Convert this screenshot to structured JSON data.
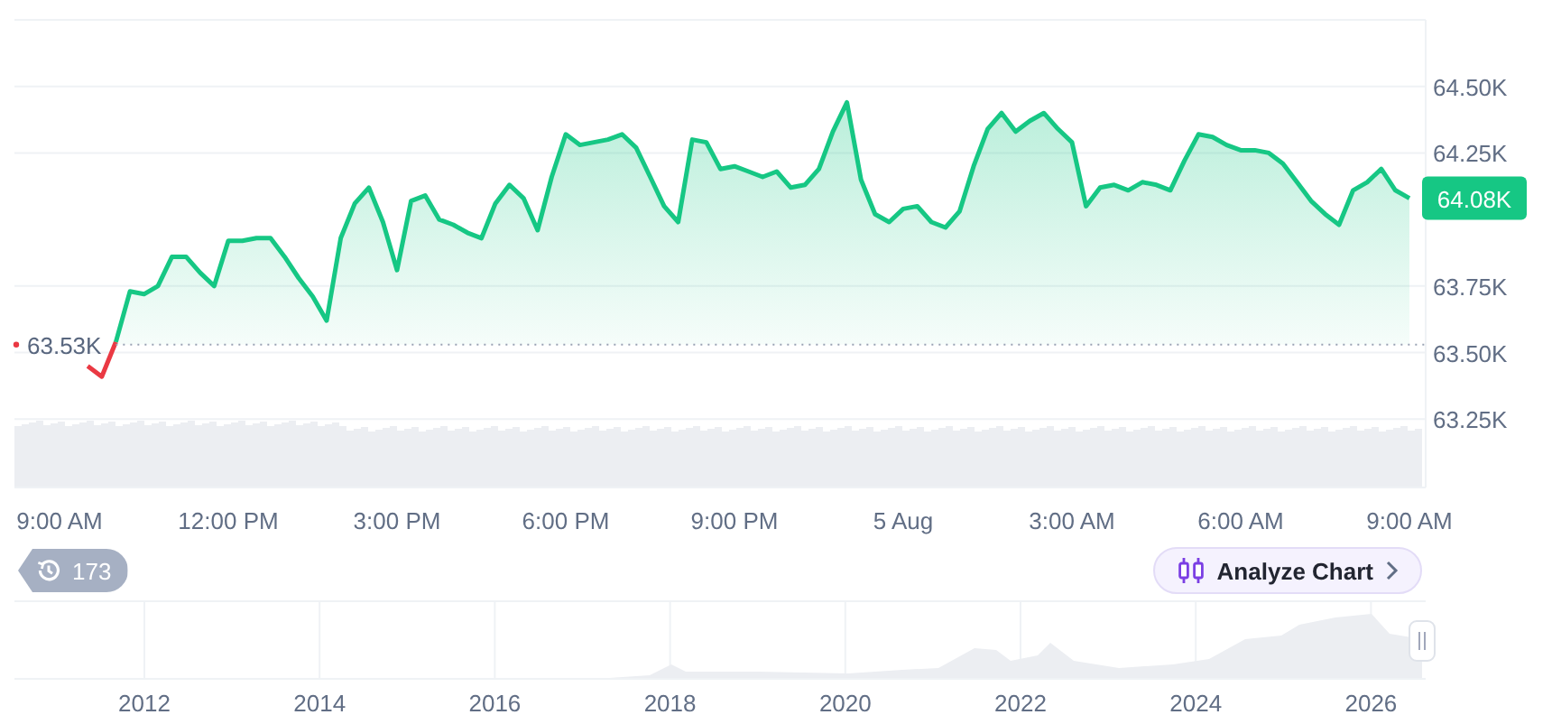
{
  "chart": {
    "open_marker": {
      "label": "63.53K"
    },
    "last_price": {
      "label": "64.08K"
    },
    "chart_data": {
      "type": "area",
      "grid": true,
      "ylim": [
        63.0,
        64.75
      ],
      "categories": [
        "9:00 AM",
        null,
        null,
        null,
        null,
        null,
        null,
        null,
        null,
        null,
        null,
        null,
        "12:00 PM",
        null,
        null,
        null,
        null,
        null,
        null,
        null,
        null,
        null,
        null,
        null,
        "3:00 PM",
        null,
        null,
        null,
        null,
        null,
        null,
        null,
        null,
        null,
        null,
        null,
        "6:00 PM",
        null,
        null,
        null,
        null,
        null,
        null,
        null,
        null,
        null,
        null,
        null,
        "9:00 PM",
        null,
        null,
        null,
        null,
        null,
        null,
        null,
        null,
        null,
        null,
        null,
        "5 Aug",
        null,
        null,
        null,
        null,
        null,
        null,
        null,
        null,
        null,
        null,
        null,
        "3:00 AM",
        null,
        null,
        null,
        null,
        null,
        null,
        null,
        null,
        null,
        null,
        null,
        "6:00 AM",
        null,
        null,
        null,
        null,
        null,
        null,
        null,
        null,
        null,
        null,
        null,
        "9:00 AM"
      ],
      "series": [
        {
          "color": "#ea3943",
          "type": "line",
          "values": [
            null,
            null,
            63.45,
            63.41,
            63.54,
            null,
            null,
            null,
            null,
            null,
            null,
            null,
            null,
            null,
            null,
            null,
            null,
            null,
            null,
            null,
            null,
            null,
            null,
            null,
            null,
            null,
            null,
            null,
            null,
            null,
            null,
            null,
            null,
            null,
            null,
            null,
            null,
            null,
            null,
            null,
            null,
            null,
            null,
            null,
            null,
            null,
            null,
            null,
            null,
            null,
            null,
            null,
            null,
            null,
            null,
            null,
            null,
            null,
            null,
            null,
            null,
            null,
            null,
            null,
            null,
            null,
            null,
            null,
            null,
            null,
            null,
            null,
            null,
            null,
            null,
            null,
            null,
            null,
            null,
            null,
            null,
            null,
            null,
            null,
            null,
            null,
            null,
            null,
            null,
            null,
            null,
            null,
            null,
            null,
            null,
            null,
            null
          ]
        },
        {
          "color": "#16c784",
          "values": [
            null,
            null,
            null,
            null,
            63.54,
            63.73,
            63.72,
            63.75,
            63.86,
            63.86,
            63.8,
            63.75,
            63.92,
            63.92,
            63.93,
            63.93,
            63.86,
            63.78,
            63.71,
            63.62,
            63.93,
            64.06,
            64.12,
            63.99,
            63.81,
            64.07,
            64.09,
            64.0,
            63.98,
            63.95,
            63.93,
            64.06,
            64.13,
            64.08,
            63.96,
            64.16,
            64.32,
            64.28,
            64.29,
            64.3,
            64.32,
            64.27,
            64.16,
            64.05,
            63.99,
            64.3,
            64.29,
            64.19,
            64.2,
            64.18,
            64.16,
            64.18,
            64.12,
            64.13,
            64.19,
            64.33,
            64.44,
            64.15,
            64.02,
            63.99,
            64.04,
            64.05,
            63.99,
            63.97,
            64.03,
            64.2,
            64.34,
            64.4,
            64.33,
            64.37,
            64.4,
            64.34,
            64.29,
            64.05,
            64.12,
            64.13,
            64.11,
            64.14,
            64.13,
            64.11,
            64.22,
            64.32,
            64.31,
            64.28,
            64.26,
            64.26,
            64.25,
            64.21,
            64.14,
            64.07,
            64.02,
            63.98,
            64.11,
            64.14,
            64.19,
            64.11,
            64.08
          ]
        }
      ],
      "yticks": [
        {
          "value": 63.25,
          "label": "63.25K"
        },
        {
          "value": 63.5,
          "label": "63.50K"
        },
        {
          "value": 63.75,
          "label": "63.75K"
        },
        {
          "value": 64.25,
          "label": "64.25K"
        },
        {
          "value": 64.5,
          "label": "64.50K"
        }
      ]
    }
  },
  "events_badge": {
    "label": "173"
  },
  "analyze_button": {
    "label": "Analyze Chart"
  },
  "navigator": {
    "years": [
      "2012",
      "2014",
      "2016",
      "2018",
      "2020",
      "2022",
      "2024",
      "2026"
    ]
  }
}
